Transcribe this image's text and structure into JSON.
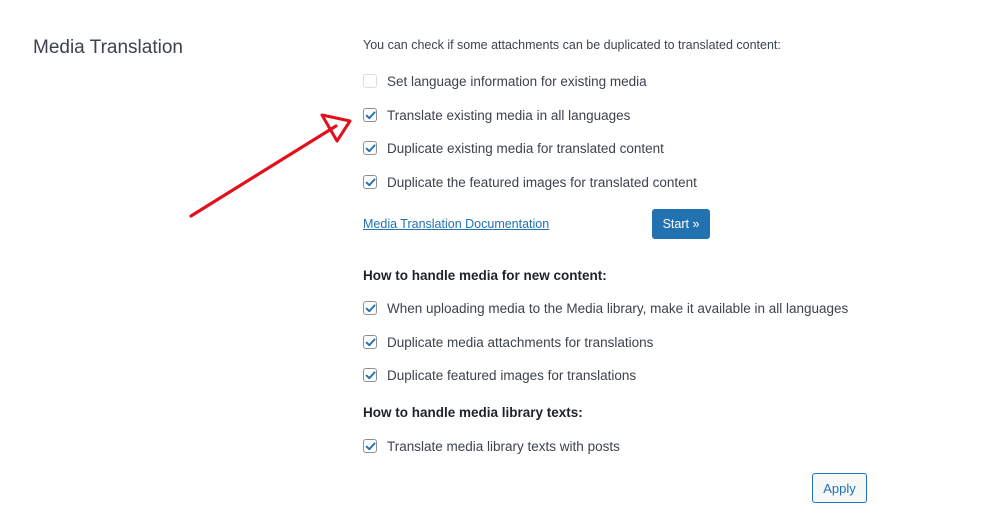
{
  "section": {
    "title": "Media Translation"
  },
  "existing": {
    "intro": "You can check if some attachments can be duplicated to translated content:",
    "options": [
      {
        "label": "Set language information for existing media",
        "checked": false
      },
      {
        "label": "Translate existing media in all languages",
        "checked": true
      },
      {
        "label": "Duplicate existing media for translated content",
        "checked": true
      },
      {
        "label": "Duplicate the featured images for translated content",
        "checked": true
      }
    ],
    "doc_link": "Media Translation Documentation",
    "start_label": "Start »"
  },
  "new_content": {
    "heading": "How to handle media for new content:",
    "options": [
      {
        "label": "When uploading media to the Media library, make it available in all languages",
        "checked": true
      },
      {
        "label": "Duplicate media attachments for translations",
        "checked": true
      },
      {
        "label": "Duplicate featured images for translations",
        "checked": true
      }
    ]
  },
  "library_texts": {
    "heading": "How to handle media library texts:",
    "options": [
      {
        "label": "Translate media library texts with posts",
        "checked": true
      }
    ]
  },
  "apply_label": "Apply",
  "colors": {
    "accent": "#2271b1",
    "annotation_arrow": "#e3101b"
  }
}
